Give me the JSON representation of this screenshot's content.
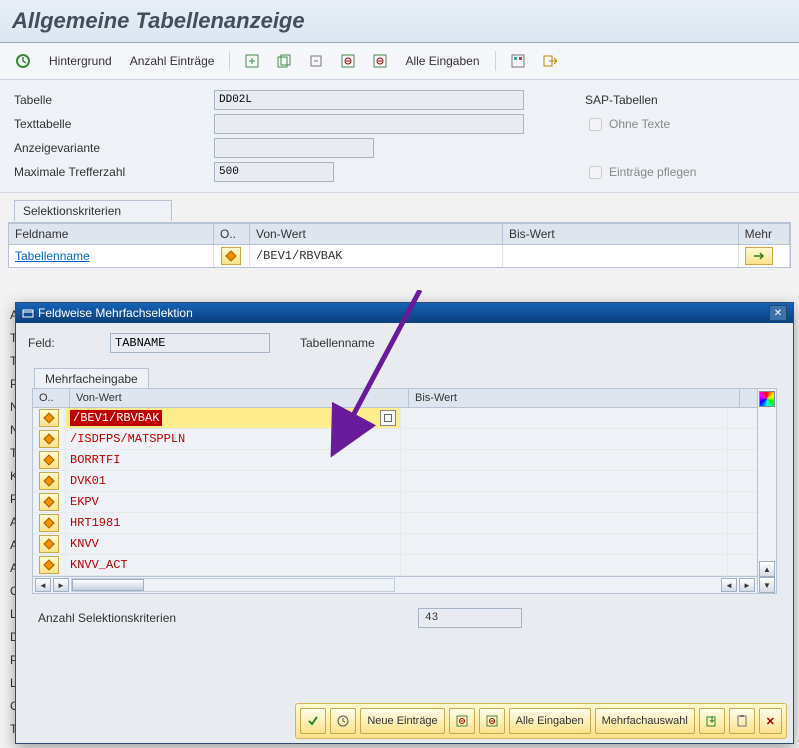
{
  "title": "Allgemeine Tabellenanzeige",
  "toolbar": {
    "hintergrund": "Hintergrund",
    "anzahl": "Anzahl Einträge",
    "alle_eingaben": "Alle Eingaben"
  },
  "form": {
    "tabelle_label": "Tabelle",
    "tabelle_value": "DD02L",
    "texttabelle_label": "Texttabelle",
    "texttabelle_value": "",
    "anzeigevariante_label": "Anzeigevariante",
    "anzeigevariante_value": "",
    "maxtreffer_label": "Maximale Trefferzahl",
    "maxtreffer_value": "500",
    "sap_tabellen": "SAP-Tabellen",
    "ohne_texte": "Ohne Texte",
    "eintraege_pflegen": "Einträge pflegen"
  },
  "selkrit": {
    "title": "Selektionskriterien",
    "head_feldname": "Feldname",
    "head_opt": "O..",
    "head_von": "Von-Wert",
    "head_bis": "Bis-Wert",
    "head_mehr": "Mehr",
    "row0_feld": "Tabellenname",
    "row0_von": "/BEV1/RBVBAK"
  },
  "dialog": {
    "title": "Feldweise Mehrfachselektion",
    "feld_label": "Feld:",
    "feld_value": "TABNAME",
    "feld_desc": "Tabellenname",
    "mf_tab": "Mehrfacheingabe",
    "head_opt": "O..",
    "head_von": "Von-Wert",
    "head_bis": "Bis-Wert",
    "rows": [
      "/BEV1/RBVBAK",
      "/ISDFPS/MATSPPLN",
      "BORRTFI",
      "DVK01",
      "EKPV",
      "HRT1981",
      "KNVV",
      "KNVV_ACT"
    ],
    "anzahl_label": "Anzahl Selektionskriterien",
    "anzahl_value": "43",
    "footer_neue": "Neue Einträge",
    "footer_alle": "Alle Eingaben",
    "footer_mehrfach": "Mehrfachauswahl"
  }
}
